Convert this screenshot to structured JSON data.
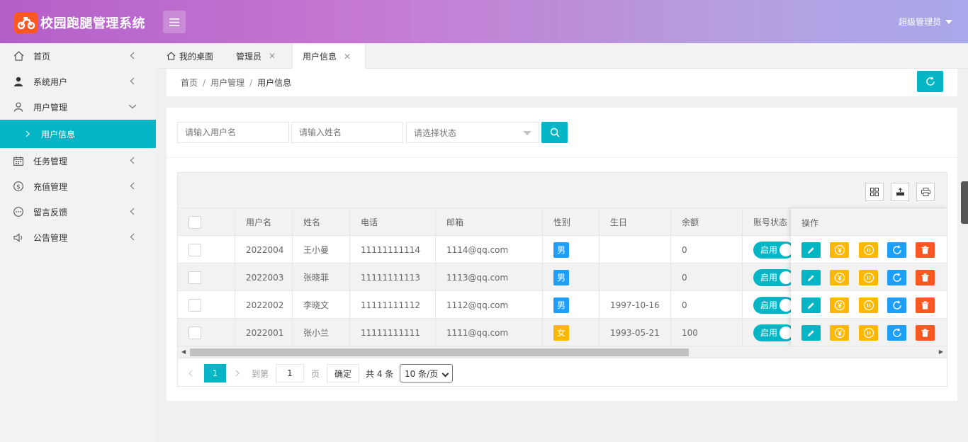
{
  "app": {
    "title": "校园跑腿管理系统",
    "user": "超级管理员"
  },
  "sidebar": {
    "items": [
      {
        "label": "首页"
      },
      {
        "label": "系统用户"
      },
      {
        "label": "用户管理"
      },
      {
        "label": "用户信息"
      },
      {
        "label": "任务管理"
      },
      {
        "label": "充值管理"
      },
      {
        "label": "留言反馈"
      },
      {
        "label": "公告管理"
      }
    ]
  },
  "tabs": [
    {
      "label": "我的桌面"
    },
    {
      "label": "管理员"
    },
    {
      "label": "用户信息"
    }
  ],
  "breadcrumb": [
    "首页",
    "用户管理",
    "用户信息"
  ],
  "search": {
    "username_placeholder": "请输入用户名",
    "name_placeholder": "请输入姓名",
    "status_placeholder": "请选择状态"
  },
  "table": {
    "columns": [
      "用户名",
      "姓名",
      "电话",
      "邮箱",
      "性别",
      "生日",
      "余额",
      "账号状态",
      "操作"
    ],
    "rows": [
      {
        "username": "2022004",
        "name": "王小曼",
        "phone": "11111111114",
        "email": "1114@qq.com",
        "gender": "男",
        "birthday": "",
        "balance": "0",
        "status": "启用"
      },
      {
        "username": "2022003",
        "name": "张晓菲",
        "phone": "11111111113",
        "email": "1113@qq.com",
        "gender": "男",
        "birthday": "",
        "balance": "0",
        "status": "启用"
      },
      {
        "username": "2022002",
        "name": "李晓文",
        "phone": "11111111112",
        "email": "1112@qq.com",
        "gender": "男",
        "birthday": "1997-10-16",
        "balance": "0",
        "status": "启用"
      },
      {
        "username": "2022001",
        "name": "张小兰",
        "phone": "11111111111",
        "email": "1111@qq.com",
        "gender": "女",
        "birthday": "1993-05-21",
        "balance": "100",
        "status": "启用"
      }
    ]
  },
  "pagination": {
    "current": "1",
    "goto_label": "到第",
    "goto_value": "1",
    "page_unit": "页",
    "confirm": "确定",
    "total": "共 4 条",
    "page_size": "10 条/页"
  },
  "colors": {
    "accent": "#04b5c6",
    "male": "#1e9fff",
    "female": "#ffb800",
    "danger": "#ff5722"
  },
  "icons": {
    "op_edit": "pencil-icon",
    "op_recharge": "yen-icon",
    "op_pause": "pause-icon",
    "op_reset": "refresh-icon",
    "op_delete": "trash-icon"
  }
}
